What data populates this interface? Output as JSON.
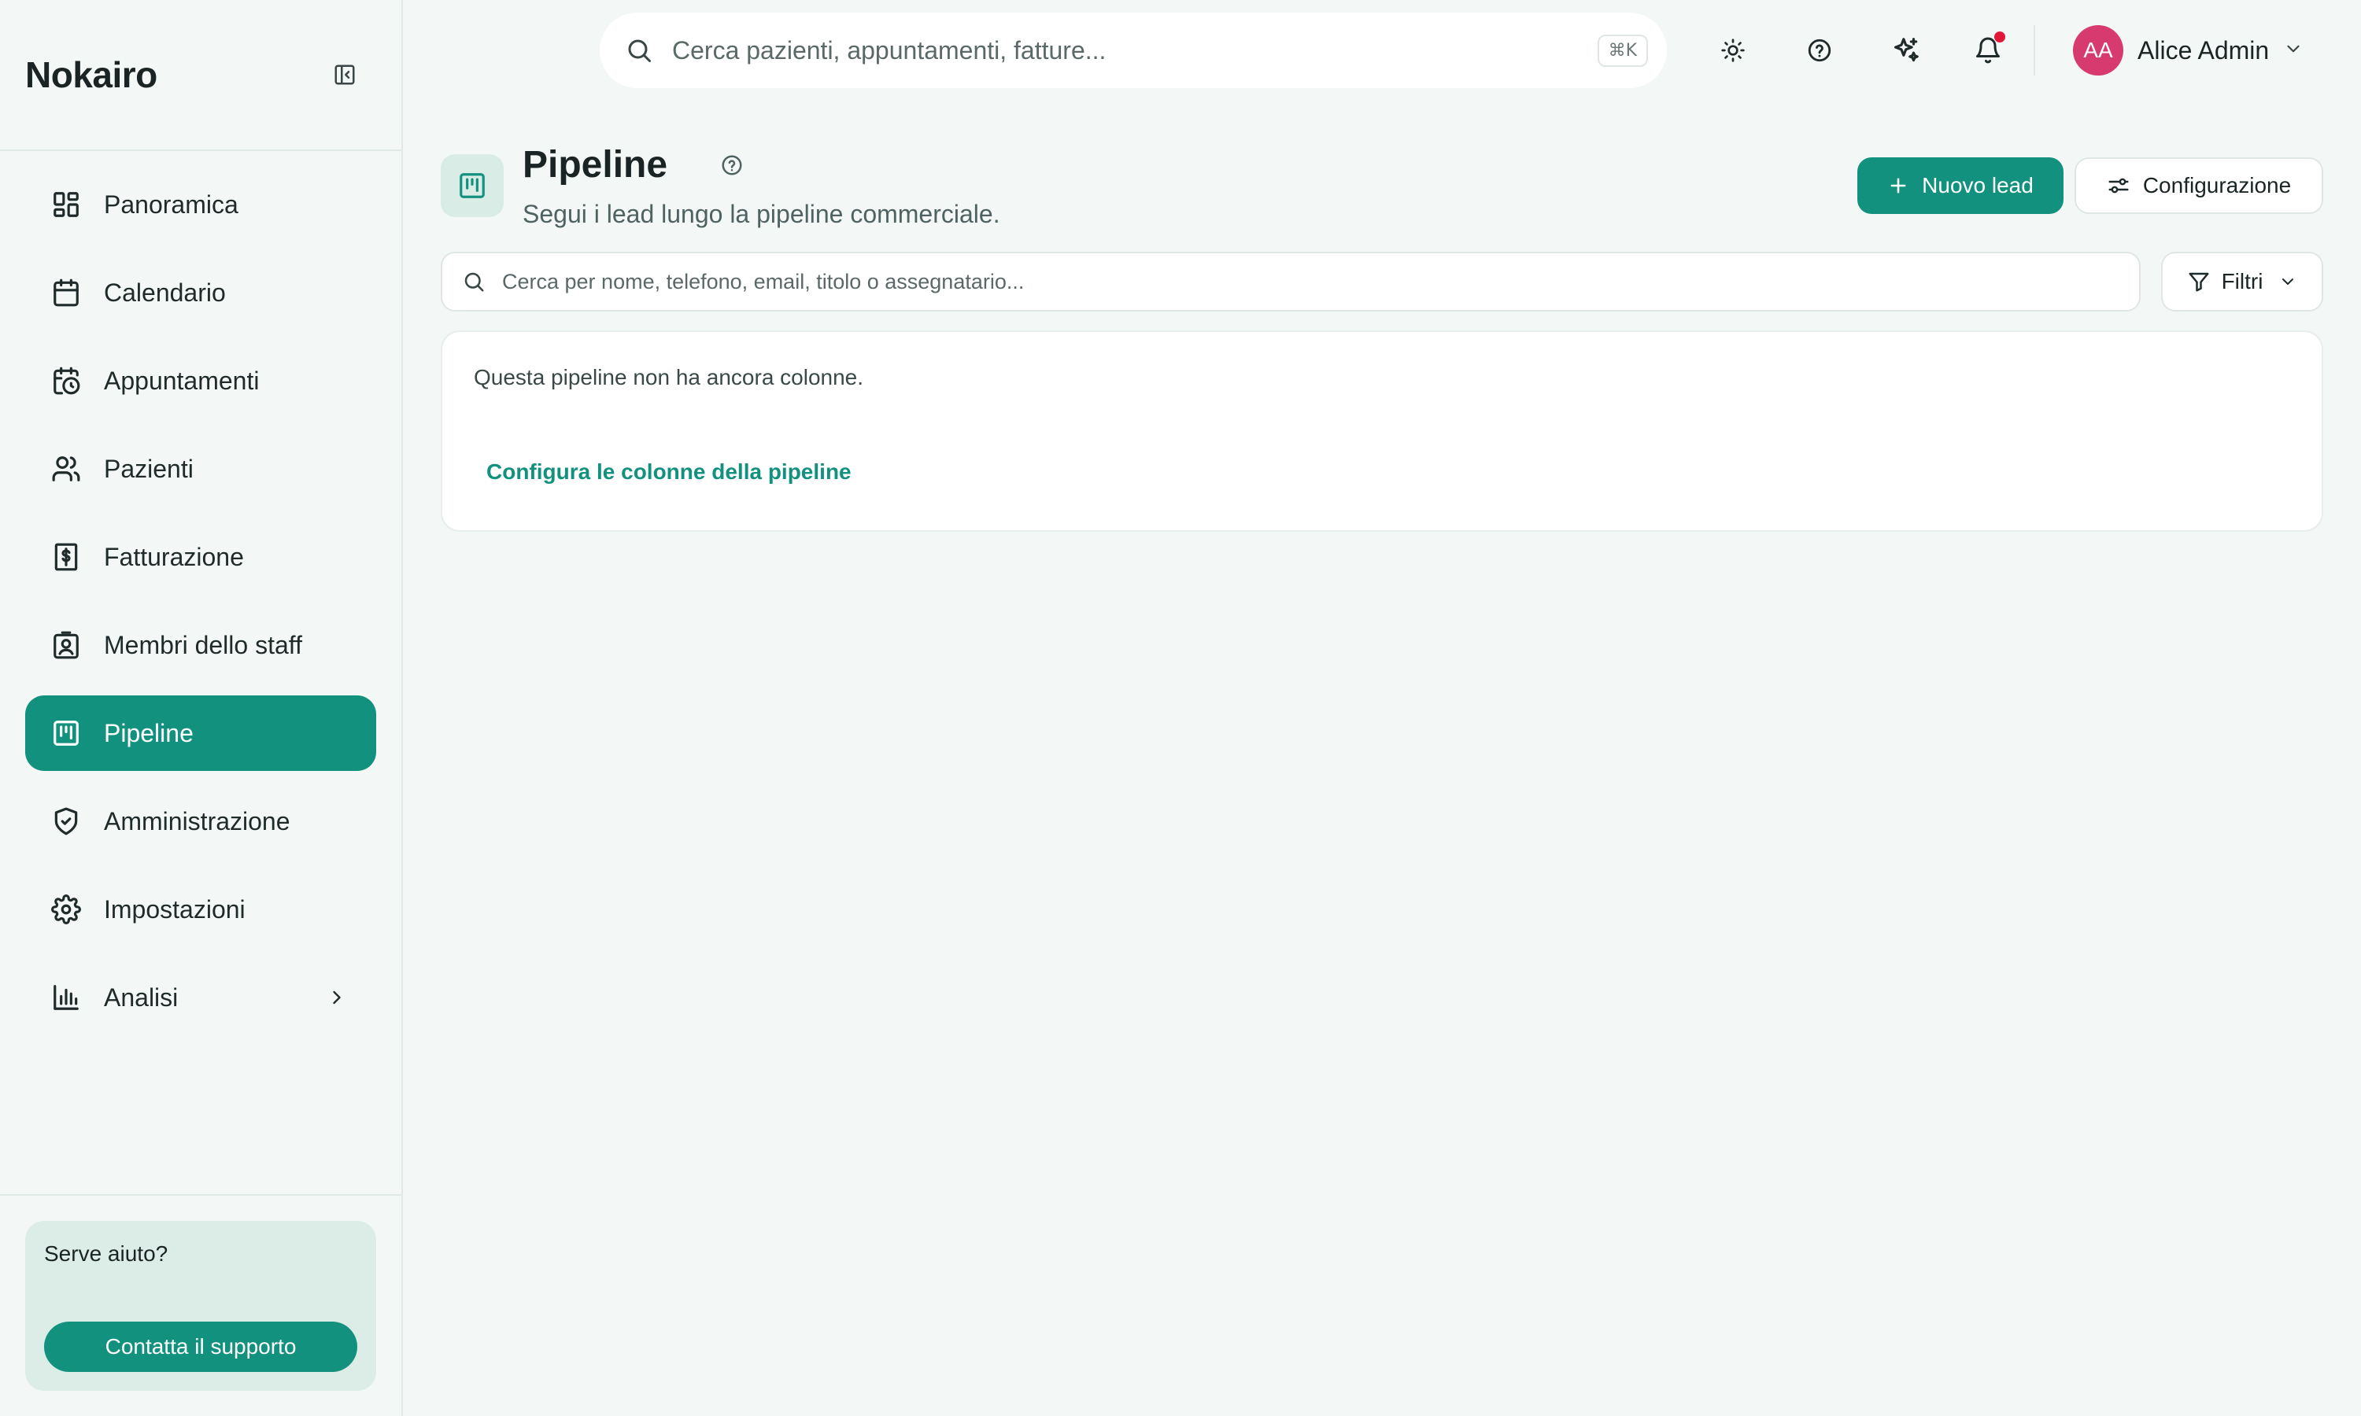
{
  "sidebar": {
    "brand": "Nokairo",
    "items": [
      {
        "label": "Panoramica",
        "icon": "dashboard-icon"
      },
      {
        "label": "Calendario",
        "icon": "calendar-icon"
      },
      {
        "label": "Appuntamenti",
        "icon": "calendar-clock-icon"
      },
      {
        "label": "Pazienti",
        "icon": "users-icon"
      },
      {
        "label": "Fatturazione",
        "icon": "receipt-dollar-icon"
      },
      {
        "label": "Membri dello staff",
        "icon": "badge-icon"
      },
      {
        "label": "Pipeline",
        "icon": "kanban-icon",
        "active": true
      },
      {
        "label": "Amministrazione",
        "icon": "shield-check-icon"
      },
      {
        "label": "Impostazioni",
        "icon": "gear-icon"
      },
      {
        "label": "Analisi",
        "icon": "bar-chart-icon",
        "has_submenu": true
      }
    ],
    "help": {
      "title": "Serve aiuto?",
      "button": "Contatta il supporto"
    }
  },
  "topbar": {
    "search_placeholder": "Cerca pazienti, appuntamenti, fatture...",
    "shortcut": "⌘K",
    "user": {
      "initials": "AA",
      "name": "Alice Admin"
    },
    "notification_dot": true
  },
  "page": {
    "title": "Pipeline",
    "subtitle": "Segui i lead lungo la pipeline commerciale.",
    "new_lead_label": "Nuovo lead",
    "config_label": "Configurazione",
    "lead_search_placeholder": "Cerca per nome, telefono, email, titolo o assegnatario...",
    "filters_label": "Filtri",
    "empty_message": "Questa pipeline non ha ancora colonne.",
    "empty_action": "Configura le colonne della pipeline"
  },
  "colors": {
    "accent": "#13917f",
    "avatar": "#d63a6e",
    "notification": "#e2183a",
    "background": "#f3f8f6"
  }
}
